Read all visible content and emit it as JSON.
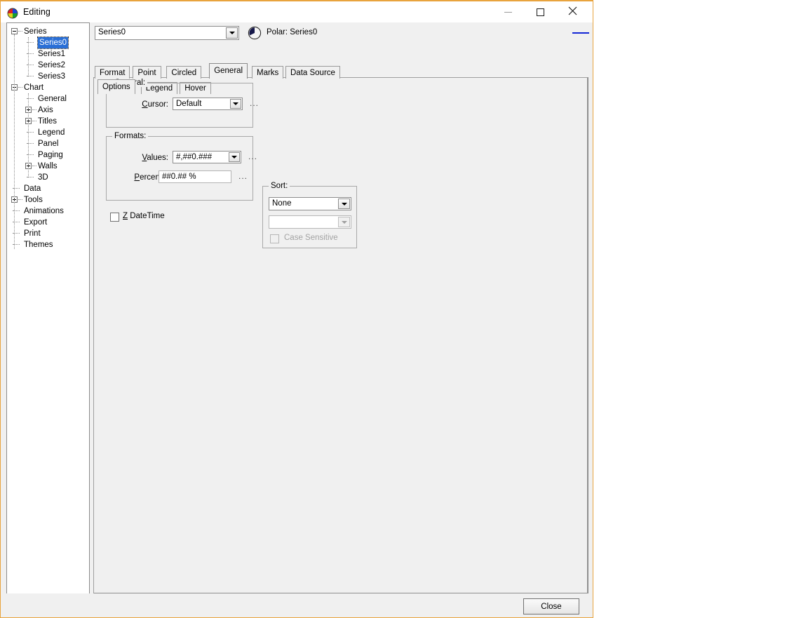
{
  "window": {
    "title": "Editing",
    "icon": "chart-pie-icon",
    "minimize_label": "Minimize",
    "maximize_label": "Maximize",
    "close_label": "Close",
    "frame_color": "#e8a33d"
  },
  "tree": {
    "nodes": [
      {
        "label": "Series",
        "depth": 0,
        "expander": "minus",
        "selected": false
      },
      {
        "label": "Series0",
        "depth": 1,
        "expander": "none",
        "selected": true
      },
      {
        "label": "Series1",
        "depth": 1,
        "expander": "none",
        "selected": false
      },
      {
        "label": "Series2",
        "depth": 1,
        "expander": "none",
        "selected": false
      },
      {
        "label": "Series3",
        "depth": 1,
        "expander": "none",
        "selected": false
      },
      {
        "label": "Chart",
        "depth": 0,
        "expander": "minus",
        "selected": false
      },
      {
        "label": "General",
        "depth": 1,
        "expander": "none",
        "selected": false
      },
      {
        "label": "Axis",
        "depth": 1,
        "expander": "plus",
        "selected": false
      },
      {
        "label": "Titles",
        "depth": 1,
        "expander": "plus",
        "selected": false
      },
      {
        "label": "Legend",
        "depth": 1,
        "expander": "none",
        "selected": false
      },
      {
        "label": "Panel",
        "depth": 1,
        "expander": "none",
        "selected": false
      },
      {
        "label": "Paging",
        "depth": 1,
        "expander": "none",
        "selected": false
      },
      {
        "label": "Walls",
        "depth": 1,
        "expander": "plus",
        "selected": false
      },
      {
        "label": "3D",
        "depth": 1,
        "expander": "none",
        "selected": false
      },
      {
        "label": "Data",
        "depth": 0,
        "expander": "none",
        "selected": false
      },
      {
        "label": "Tools",
        "depth": 0,
        "expander": "plus",
        "selected": false
      },
      {
        "label": "Animations",
        "depth": 0,
        "expander": "none",
        "selected": false
      },
      {
        "label": "Export",
        "depth": 0,
        "expander": "none",
        "selected": false
      },
      {
        "label": "Print",
        "depth": 0,
        "expander": "none",
        "selected": false
      },
      {
        "label": "Themes",
        "depth": 0,
        "expander": "none",
        "selected": false
      }
    ]
  },
  "header": {
    "series_combo_value": "Series0",
    "polar_icon": "polar-chart-icon",
    "polar_label": "Polar: Series0",
    "series_color": "#1326d6"
  },
  "main_tabs": [
    {
      "label": "Format",
      "active": false
    },
    {
      "label": "Point",
      "active": false
    },
    {
      "label": "Circled",
      "active": false
    },
    {
      "label": "General",
      "active": true
    },
    {
      "label": "Marks",
      "active": false
    },
    {
      "label": "Data Source",
      "active": false
    }
  ],
  "sub_tabs": [
    {
      "label": "Options",
      "active": true
    },
    {
      "label": "Legend",
      "active": false
    },
    {
      "label": "Hover",
      "active": false
    }
  ],
  "general_group": {
    "title": "General:",
    "cursor_label": "Cursor:",
    "cursor_value": "Default",
    "cursor_ellipsis": "..."
  },
  "formats_group": {
    "title": "Formats:",
    "values_label": "Values:",
    "values_value": "#,##0.###",
    "values_ellipsis": "...",
    "percents_label": "Percents:",
    "percents_value": "##0.## %",
    "percents_ellipsis": "..."
  },
  "z_datetime": {
    "label": "Z DateTime",
    "checked": false
  },
  "sort_group": {
    "title": "Sort:",
    "sort_value": "None",
    "secondary_value": "",
    "case_sensitive_label": "Case Sensitive",
    "case_sensitive_checked": false,
    "case_sensitive_enabled": false
  },
  "footer": {
    "close_label": "Close"
  }
}
